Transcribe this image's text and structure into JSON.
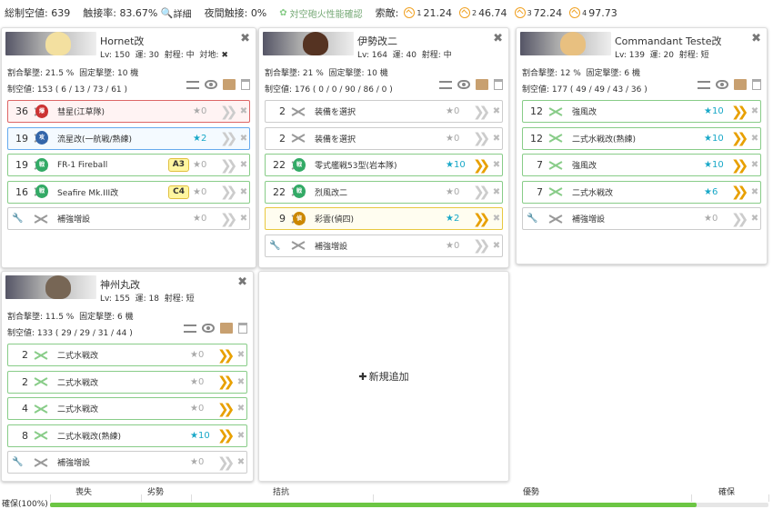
{
  "summary": {
    "air_power_label": "総制空値:",
    "air_power": "639",
    "contact_label": "触接率:",
    "contact": "83.67%",
    "detail_label": "詳細",
    "night_contact_label": "夜間触接:",
    "night_contact": "0%",
    "aa_check_label": "対空砲火性能確認",
    "enemy_label": "索敵:",
    "enemies": [
      {
        "sub": "1",
        "value": "21.24"
      },
      {
        "sub": "2",
        "value": "46.74"
      },
      {
        "sub": "3",
        "value": "72.24"
      },
      {
        "sub": "4",
        "value": "97.73"
      }
    ]
  },
  "ships": [
    {
      "name": "Hornet改",
      "lv": "Lv: 150",
      "luck": "運: 30",
      "range": "射程: 中",
      "extra": "対地:",
      "extra_icon": "✖",
      "shoot_rate": "割合撃墜: 21.5 %",
      "fixed_rate": "固定撃墜: 10 機",
      "air_value": "制空値: 153 ( 6 / 13 / 73 / 61 )",
      "slots": [
        {
          "count": "36",
          "name": "彗星(江草隊)",
          "star": "★0",
          "style": "red",
          "badge": "爆",
          "badge_color": "#c33",
          "chev": "grey"
        },
        {
          "count": "19",
          "name": "流星改(一航戦/熟練)",
          "star": "★2",
          "style": "blue",
          "badge": "攻",
          "badge_color": "#36a",
          "chev": "grey"
        },
        {
          "count": "19",
          "name": "FR-1 Fireball",
          "star": "★0",
          "style": "green",
          "badge": "戦",
          "badge_color": "#3a6",
          "chev": "grey",
          "tag": "A3"
        },
        {
          "count": "16",
          "name": "Seafire Mk.III改",
          "star": "★0",
          "style": "green",
          "badge": "戦",
          "badge_color": "#3a6",
          "chev": "grey",
          "tag": "C4"
        },
        {
          "count": "",
          "name": "補強増設",
          "star": "★0",
          "style": "plain",
          "chev": "grey",
          "wrench": true
        }
      ]
    },
    {
      "name": "伊勢改二",
      "lv": "Lv: 164",
      "luck": "運: 40",
      "range": "射程: 中",
      "extra": "",
      "extra_icon": "",
      "shoot_rate": "割合撃墜: 21 %",
      "fixed_rate": "固定撃墜: 10 機",
      "air_value": "制空値: 176 ( 0 / 0 / 90 / 86 / 0 )",
      "slots": [
        {
          "count": "2",
          "name": "装備を選択",
          "star": "★0",
          "style": "plain",
          "chev": "grey"
        },
        {
          "count": "2",
          "name": "装備を選択",
          "star": "★0",
          "style": "plain",
          "chev": "grey"
        },
        {
          "count": "22",
          "name": "零式艦戦53型(岩本隊)",
          "star": "★10",
          "style": "green",
          "badge": "戦",
          "badge_color": "#3a6",
          "chev": "gold"
        },
        {
          "count": "22",
          "name": "烈風改二",
          "star": "★0",
          "style": "green",
          "badge": "戦",
          "badge_color": "#3a6",
          "chev": "grey"
        },
        {
          "count": "9",
          "name": "彩雲(偵四)",
          "star": "★2",
          "style": "yellow",
          "badge": "偵",
          "badge_color": "#c80",
          "chev": "gold"
        },
        {
          "count": "",
          "name": "補強増設",
          "star": "★0",
          "style": "plain",
          "chev": "grey",
          "wrench": true
        }
      ]
    },
    {
      "name": "Commandant Teste改",
      "lv": "Lv: 139",
      "luck": "運: 20",
      "range": "射程: 短",
      "extra": "",
      "extra_icon": "",
      "shoot_rate": "割合撃墜: 12 %",
      "fixed_rate": "固定撃墜: 6 機",
      "air_value": "制空値: 177 ( 49 / 49 / 43 / 36 )",
      "slots": [
        {
          "count": "12",
          "name": "強風改",
          "star": "★10",
          "style": "green",
          "chev": "gold",
          "plane": "green"
        },
        {
          "count": "12",
          "name": "二式水戦改(熟練)",
          "star": "★10",
          "style": "green",
          "chev": "gold",
          "plane": "green"
        },
        {
          "count": "7",
          "name": "強風改",
          "star": "★10",
          "style": "green",
          "chev": "gold",
          "plane": "green"
        },
        {
          "count": "7",
          "name": "二式水戦改",
          "star": "★6",
          "style": "green",
          "chev": "gold",
          "plane": "green"
        },
        {
          "count": "",
          "name": "補強増設",
          "star": "★0",
          "style": "plain",
          "chev": "grey",
          "wrench": true
        }
      ]
    },
    {
      "name": "神州丸改",
      "lv": "Lv: 155",
      "luck": "運: 18",
      "range": "射程: 短",
      "extra": "",
      "extra_icon": "",
      "shoot_rate": "割合撃墜: 11.5 %",
      "fixed_rate": "固定撃墜: 6 機",
      "air_value": "制空値: 133 ( 29 / 29 / 31 / 44 )",
      "slots": [
        {
          "count": "2",
          "name": "二式水戦改",
          "star": "★0",
          "style": "green",
          "chev": "gold",
          "plane": "green"
        },
        {
          "count": "2",
          "name": "二式水戦改",
          "star": "★0",
          "style": "green",
          "chev": "gold",
          "plane": "green"
        },
        {
          "count": "4",
          "name": "二式水戦改",
          "star": "★0",
          "style": "green",
          "chev": "gold",
          "plane": "green"
        },
        {
          "count": "8",
          "name": "二式水戦改(熟練)",
          "star": "★10",
          "style": "green",
          "chev": "gold",
          "plane": "green"
        },
        {
          "count": "",
          "name": "補強増設",
          "star": "★0",
          "style": "plain",
          "chev": "grey",
          "wrench": true
        }
      ]
    }
  ],
  "new_card_label": "新規追加",
  "status_bar": {
    "ensure_label": "確保(100%)",
    "labels": [
      "喪失",
      "劣勢",
      "拮抗",
      "優勢",
      "確保"
    ],
    "progress": 0.9
  },
  "colors": {
    "accent_green": "#6cc644",
    "gold": "#e8a000",
    "star_cyan": "#19a8c8"
  }
}
